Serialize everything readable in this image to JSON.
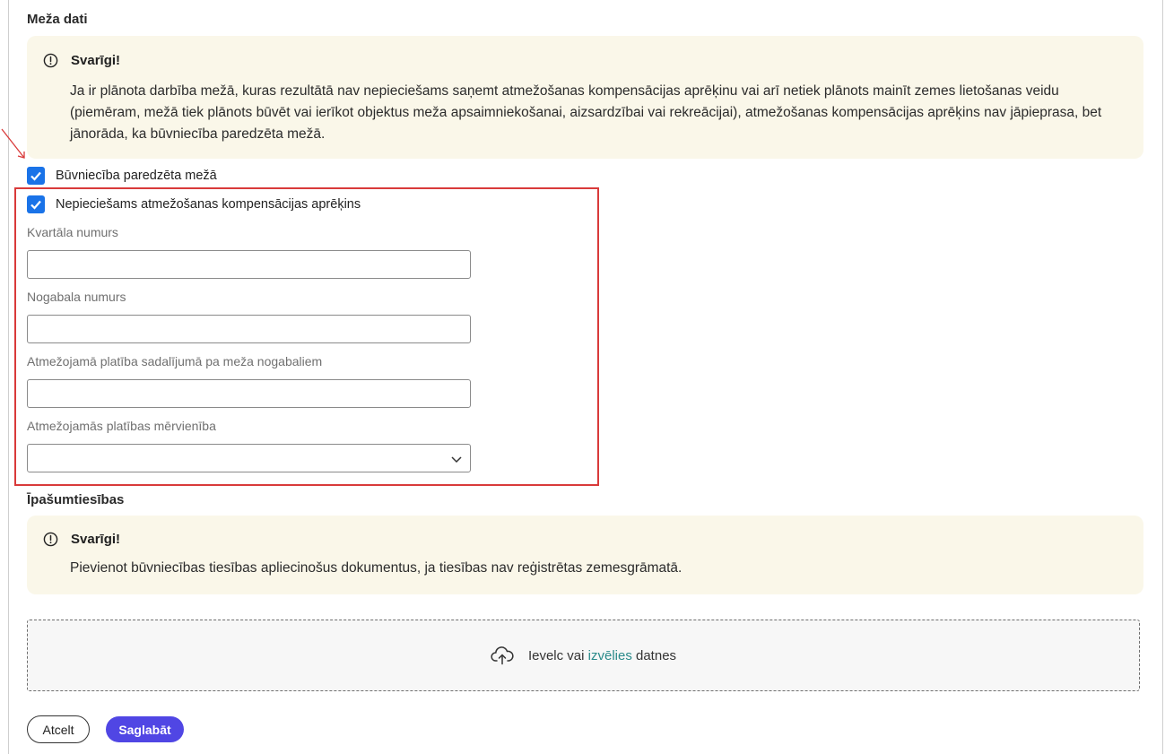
{
  "forest": {
    "section_title": "Meža dati",
    "notice_title": "Svarīgi!",
    "notice_text": "Ja ir plānota darbība mežā, kuras rezultātā nav nepieciešams saņemt atmežošanas kompensācijas aprēķinu vai arī netiek plānots mainīt zemes lietošanas veidu (piemēram, mežā tiek plānots būvēt vai ierīkot objektus meža apsaimniekošanai, aizsardzībai vai rekreācijai), atmežošanas kompensācijas aprēķins nav jāpieprasa, bet jānorāda, ka būvniecība paredzēta mežā.",
    "checkbox_construction_label": "Būvniecība paredzēta mežā",
    "checkbox_construction_checked": true,
    "checkbox_compensation_label": "Nepieciešams atmežošanas kompensācijas aprēķins",
    "checkbox_compensation_checked": true,
    "quarter_label": "Kvartāla numurs",
    "quarter_value": "",
    "plot_label": "Nogabala numurs",
    "plot_value": "",
    "area_label": "Atmežojamā platība sadalījumā pa meža nogabaliem",
    "area_value": "",
    "unit_label": "Atmežojamās platības mērvienība",
    "unit_value": ""
  },
  "ownership": {
    "section_title": "Īpašumtiesības",
    "notice_title": "Svarīgi!",
    "notice_text": "Pievienot būvniecības tiesības apliecinošus dokumentus, ja tiesības nav reģistrētas zemesgrāmatā."
  },
  "upload": {
    "text_before": "Ievelc vai ",
    "link_text": "izvēlies",
    "text_after": " datnes"
  },
  "actions": {
    "cancel_label": "Atcelt",
    "save_label": "Saglabāt"
  },
  "colors": {
    "accent": "#5046e4",
    "checkbox": "#1a73e8",
    "notice_bg": "#faf7e9",
    "highlight_frame": "#d93a3a",
    "link": "#2a8a8a"
  }
}
